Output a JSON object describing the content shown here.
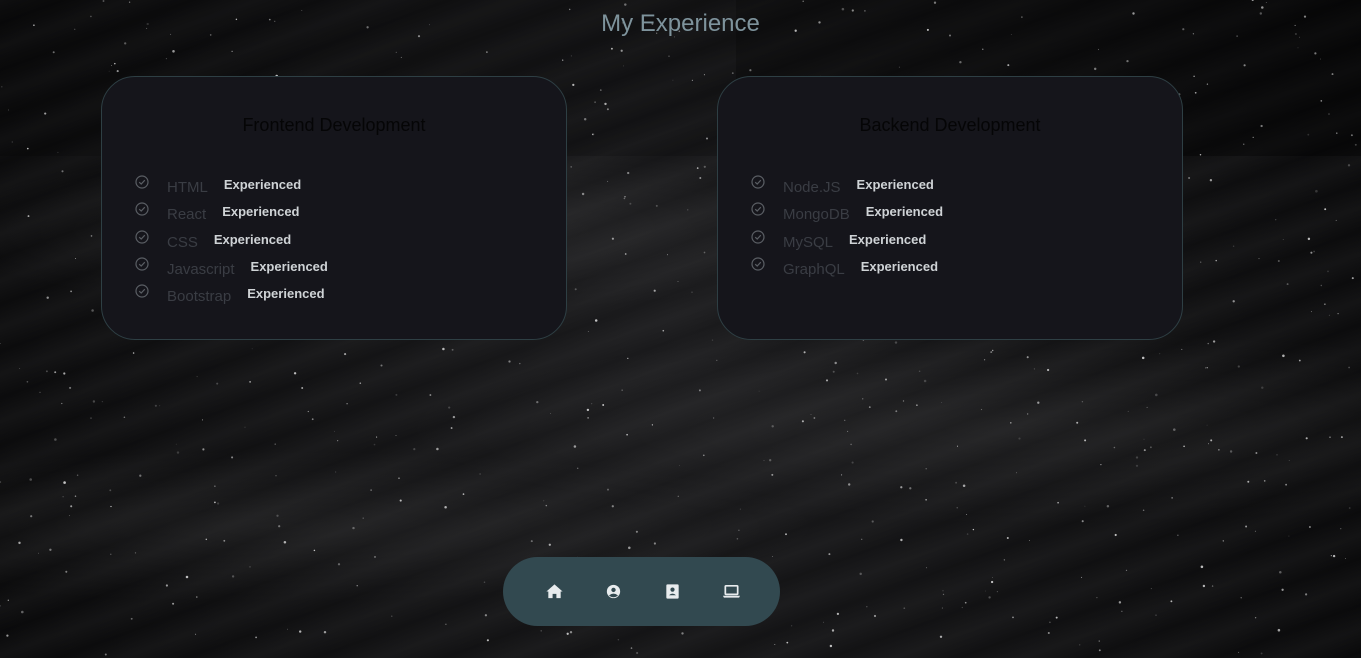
{
  "page": {
    "title": "My Experience"
  },
  "frontend": {
    "title": "Frontend Development",
    "skills": [
      {
        "name": "HTML",
        "level": "Experienced"
      },
      {
        "name": "React",
        "level": "Experienced"
      },
      {
        "name": "CSS",
        "level": "Experienced"
      },
      {
        "name": "Javascript",
        "level": "Experienced"
      },
      {
        "name": "Bootstrap",
        "level": "Experienced"
      }
    ]
  },
  "backend": {
    "title": "Backend Development",
    "skills": [
      {
        "name": "Node.JS",
        "level": "Experienced"
      },
      {
        "name": "MongoDB",
        "level": "Experienced"
      },
      {
        "name": "MySQL",
        "level": "Experienced"
      },
      {
        "name": "GraphQL",
        "level": "Experienced"
      }
    ]
  },
  "nav": {
    "items": [
      {
        "icon": "home-icon"
      },
      {
        "icon": "user-circle-icon"
      },
      {
        "icon": "contact-book-icon"
      },
      {
        "icon": "laptop-icon"
      }
    ]
  },
  "colors": {
    "title": "#7e939c",
    "card_bg": "#15151b",
    "card_border": "#2e3f44",
    "nav_bg": "#324950",
    "icon": "#e8ecee"
  }
}
